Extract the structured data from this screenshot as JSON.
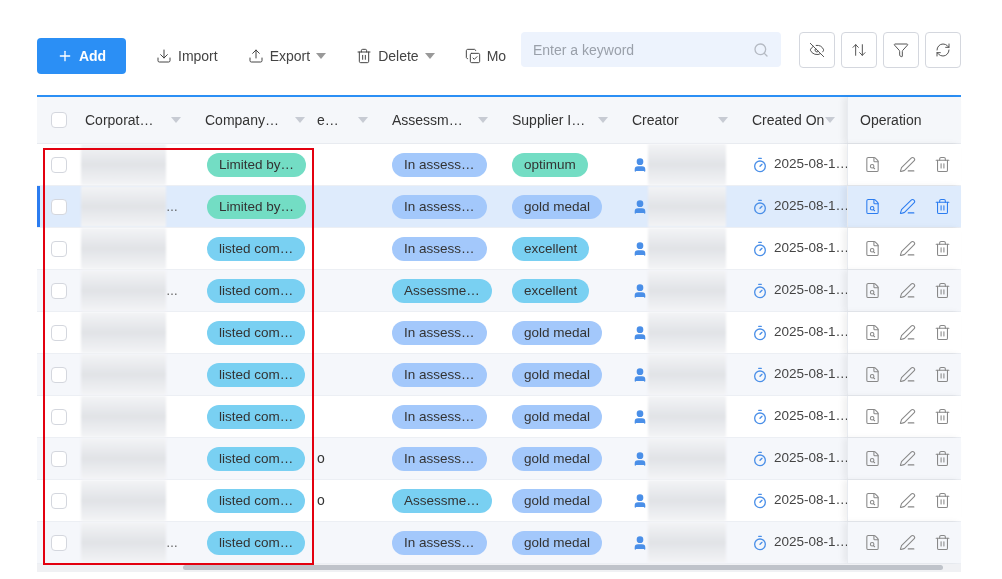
{
  "toolbar": {
    "buttons": [
      {
        "kind": "add",
        "label": "Add",
        "primary": true,
        "dropdown": false
      },
      {
        "kind": "import",
        "label": "Import",
        "primary": false,
        "dropdown": false
      },
      {
        "kind": "export",
        "label": "Export",
        "primary": false,
        "dropdown": true
      },
      {
        "kind": "delete",
        "label": "Delete",
        "primary": false,
        "dropdown": true
      },
      {
        "kind": "modify",
        "label": "Mo",
        "primary": false,
        "dropdown": false
      }
    ],
    "search": {
      "placeholder": "Enter a keyword"
    },
    "icon_buttons": [
      {
        "kind": "hide"
      },
      {
        "kind": "sort"
      },
      {
        "kind": "filter"
      },
      {
        "kind": "refresh"
      }
    ]
  },
  "table": {
    "header_checked": false,
    "columns": [
      {
        "label": "Corporat…",
        "sortable": true
      },
      {
        "label": "Company…",
        "sortable": true
      },
      {
        "label": "e…",
        "sortable": true
      },
      {
        "label": "Assessm…",
        "sortable": true
      },
      {
        "label": "Supplier I…",
        "sortable": true
      },
      {
        "label": "Creator",
        "sortable": true
      },
      {
        "label": "Created On",
        "sortable": true
      },
      {
        "label": "Operation",
        "sortable": false
      }
    ],
    "rows": [
      {
        "selected": false,
        "checked": false,
        "name_tail": "",
        "company": {
          "text": "Limited by…",
          "color": "#73ddc4"
        },
        "column_3": "",
        "assessment": {
          "text": "In assess…",
          "color": "#a3c8fb"
        },
        "supplier": {
          "text": "optimum",
          "color": "#73ddc4"
        },
        "created_on": "2025-08-1…"
      },
      {
        "selected": true,
        "checked": false,
        "name_tail": "…",
        "company": {
          "text": "Limited by…",
          "color": "#73ddc4"
        },
        "column_3": "",
        "assessment": {
          "text": "In assess…",
          "color": "#a3c8fb"
        },
        "supplier": {
          "text": "gold medal",
          "color": "#a3c8fb"
        },
        "created_on": "2025-08-1…"
      },
      {
        "selected": false,
        "checked": false,
        "name_tail": "",
        "company": {
          "text": "listed com…",
          "color": "#79d0f2"
        },
        "column_3": "",
        "assessment": {
          "text": "In assess…",
          "color": "#a3c8fb"
        },
        "supplier": {
          "text": "excellent",
          "color": "#79d0f2"
        },
        "created_on": "2025-08-1…"
      },
      {
        "selected": false,
        "checked": false,
        "name_tail": "…",
        "company": {
          "text": "listed com…",
          "color": "#79d0f2"
        },
        "column_3": "",
        "assessment": {
          "text": "Assessme…",
          "color": "#79d0f2"
        },
        "supplier": {
          "text": "excellent",
          "color": "#79d0f2"
        },
        "created_on": "2025-08-1…"
      },
      {
        "selected": false,
        "checked": false,
        "name_tail": "",
        "company": {
          "text": "listed com…",
          "color": "#79d0f2"
        },
        "column_3": "",
        "assessment": {
          "text": "In assess…",
          "color": "#a3c8fb"
        },
        "supplier": {
          "text": "gold medal",
          "color": "#a3c8fb"
        },
        "created_on": "2025-08-1…"
      },
      {
        "selected": false,
        "checked": false,
        "name_tail": "",
        "company": {
          "text": "listed com…",
          "color": "#79d0f2"
        },
        "column_3": "",
        "assessment": {
          "text": "In assess…",
          "color": "#a3c8fb"
        },
        "supplier": {
          "text": "gold medal",
          "color": "#a3c8fb"
        },
        "created_on": "2025-08-1…"
      },
      {
        "selected": false,
        "checked": false,
        "name_tail": "",
        "company": {
          "text": "listed com…",
          "color": "#79d0f2"
        },
        "column_3": "",
        "assessment": {
          "text": "In assess…",
          "color": "#a3c8fb"
        },
        "supplier": {
          "text": "gold medal",
          "color": "#a3c8fb"
        },
        "created_on": "2025-08-1…"
      },
      {
        "selected": false,
        "checked": false,
        "name_tail": "",
        "company": {
          "text": "listed com…",
          "color": "#79d0f2"
        },
        "column_3": "o",
        "assessment": {
          "text": "In assess…",
          "color": "#a3c8fb"
        },
        "supplier": {
          "text": "gold medal",
          "color": "#a3c8fb"
        },
        "created_on": "2025-08-1…"
      },
      {
        "selected": false,
        "checked": false,
        "name_tail": "",
        "company": {
          "text": "listed com…",
          "color": "#79d0f2"
        },
        "column_3": "o",
        "assessment": {
          "text": "Assessme…",
          "color": "#79d0f2"
        },
        "supplier": {
          "text": "gold medal",
          "color": "#a3c8fb"
        },
        "created_on": "2025-08-1…"
      },
      {
        "selected": false,
        "checked": false,
        "name_tail": "…",
        "company": {
          "text": "listed com…",
          "color": "#79d0f2"
        },
        "column_3": "",
        "assessment": {
          "text": "In assess…",
          "color": "#a3c8fb"
        },
        "supplier": {
          "text": "gold medal",
          "color": "#a3c8fb"
        },
        "created_on": "2025-08-1…"
      }
    ]
  },
  "highlight": {
    "visible": true
  }
}
